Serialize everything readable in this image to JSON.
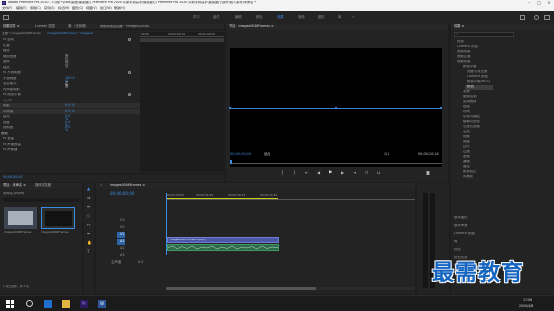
{
  "app": {
    "title": "Adobe Premiere Pro 2020 - C:\\用户\\Julia\\桌面\\最需要打 Premiere Pro 2020 从新手到高手\\最需要打\\ Premiere Pro 2020 从新手到高手\\最需要打\\操作\\给入素材\\未命名 *"
  },
  "menu": [
    "文件(F)",
    "编辑(E)",
    "剪辑(C)",
    "序列(S)",
    "标记(M)",
    "图形(G)",
    "视图(V)",
    "窗口(W)",
    "帮助(H)"
  ],
  "workspaces": [
    "学习",
    "组件",
    "编辑",
    "颜色",
    "效果",
    "音频",
    "图形",
    "库",
    "»"
  ],
  "effect_controls": {
    "tabs": [
      "效果控件 ≡",
      "Lumetri 范围",
      "源：(无剪辑)",
      "音频剪辑混合器：*images(0046)"
    ],
    "master": "主要 * images0046Frames",
    "clip": "images0046Frames * images0",
    "rows": [
      {
        "label": "fx  运动",
        "val": ""
      },
      {
        "label": "  位置",
        "val": ""
      },
      {
        "label": "  缩放",
        "val": ""
      },
      {
        "label": "  缩放宽度",
        "val": "等比缩放"
      },
      {
        "label": "  旋转",
        "val": ""
      },
      {
        "label": "  锚点",
        "val": ""
      },
      {
        "label": "fx  不透明度",
        "val": ""
      },
      {
        "label": "  不透明度",
        "val": "100.0 %"
      },
      {
        "label": "  混合模式",
        "val": "正常"
      },
      {
        "label": "  时间重映射",
        "val": ""
      },
      {
        "label": "fx  颜色平衡",
        "val": ""
      },
      {
        "label": "  ○□✎",
        "val": ""
      },
      {
        "label": "  阴影",
        "val": "0.0 %"
      },
      {
        "label": "  中间调",
        "val": "0.0 %"
      },
      {
        "label": "  高光",
        "val": "0.0 %"
      },
      {
        "label": "  亮度",
        "val": "0.0 %"
      },
      {
        "label": "  饱和度",
        "val": "0.0 %"
      },
      {
        "label": "音频",
        "val": ""
      },
      {
        "label": "fx  音量",
        "val": ""
      },
      {
        "label": "fx  声道音量",
        "val": ""
      },
      {
        "label": "fx  声像器",
        "val": ""
      }
    ],
    "timecode": "00;00;00;00",
    "ruler": [
      "00;00",
      "00;00;04;29",
      "00;00;09;29"
    ]
  },
  "program": {
    "tab": "节目：images0046Frames ≡",
    "timecode": "00;00;00;00",
    "fit": "适合",
    "quality": "1/1",
    "duration": "00;00;10;14"
  },
  "project": {
    "tab": "项目：未命名 ≡",
    "tab2": "媒体浏览器",
    "file": "未命名.prproj",
    "items": [
      "images0046Frames",
      "images0046Frames"
    ],
    "count": "1 项已选择，共 2 项"
  },
  "timeline": {
    "tab": "images0046Frames ≡",
    "timecode": "00;00;00;00",
    "ruler": [
      "00;00;00;00",
      "00;00;04;29",
      "00;00;09;29",
      "00;00;14;29"
    ],
    "video_tracks": [
      "V3",
      "V2",
      "V1"
    ],
    "audio_tracks": [
      "A1",
      "A2",
      "A3"
    ],
    "master": "主声道",
    "master_val": "0.0",
    "clip_label": "images0046Frames.mp4[V]",
    "audio_label": ""
  },
  "effects": {
    "tab": "效果 ≡",
    "search_placeholder": "",
    "categories": [
      "预设",
      "Lumetri 预设",
      "音频效果",
      "音频过渡",
      "视频效果"
    ],
    "subcats": [
      "变换",
      "图像控制",
      "实用程序",
      "扭曲",
      "时间",
      "杂色与颗粒",
      "模糊与锐化",
      "沉浸式视频",
      "生成",
      "视频",
      "调整",
      "过时",
      "过渡",
      "透视",
      "通道",
      "键控",
      "颜色校正",
      "风格化"
    ],
    "expanded": [
      "颜色平衡",
      "亮度与对比度",
      "Lumetri 颜色",
      "颜色平衡(HLS)",
      "颜色"
    ],
    "sections": [
      "基本图形",
      "基本声音",
      "Lumetri 颜色",
      "库",
      "标记",
      "历史记录",
      "信息"
    ]
  },
  "taskbar": {
    "time": "17:06",
    "date": "2020/4/8"
  },
  "watermark": "最需教育"
}
